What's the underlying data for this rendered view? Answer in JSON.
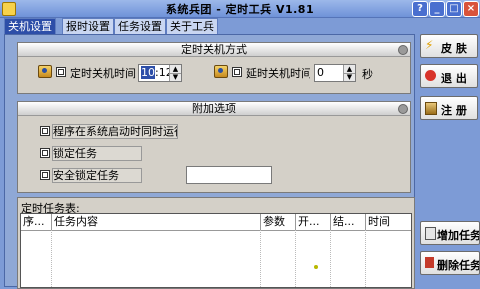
{
  "window": {
    "title": "系统兵团 - 定时工兵 V1.81",
    "buttons": [
      "?",
      "_",
      "□",
      "×"
    ]
  },
  "tabs": [
    {
      "label": "关机设置",
      "active": true
    },
    {
      "label": "报时设置",
      "active": false
    },
    {
      "label": "任务设置",
      "active": false
    },
    {
      "label": "关于工兵",
      "active": false
    }
  ],
  "shutdown_group": {
    "title": "定时关机方式",
    "timed_shutdown_label": "定时关机时间",
    "timed_shutdown_hour": "10",
    "timed_shutdown_minute": "12",
    "delay_shutdown_label": "延时关机时间",
    "delay_value": "0",
    "delay_unit": "秒"
  },
  "extra_group": {
    "title": "附加选项",
    "options": [
      "程序在系统启动时同时运行",
      "锁定任务",
      "安全锁定任务"
    ],
    "password_value": ""
  },
  "side_buttons": {
    "skin": "皮 肤",
    "exit": "退 出",
    "register": "注 册",
    "add_task": "增加任务",
    "delete_task": "删除任务"
  },
  "task_table": {
    "caption": "定时任务表:",
    "columns": [
      "序...",
      "任务内容",
      "参数",
      "开...",
      "结...",
      "时间"
    ]
  }
}
